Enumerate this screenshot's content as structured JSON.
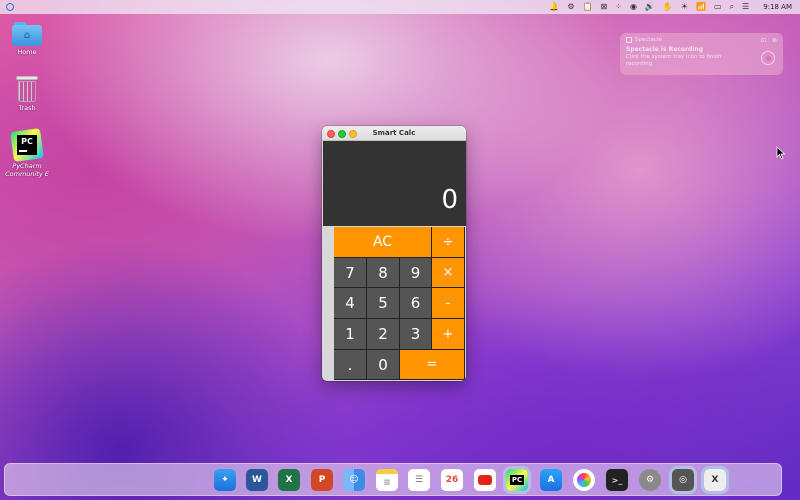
{
  "menubar": {
    "status_icons": [
      "bell-icon",
      "tool-icon",
      "clipboard-icon",
      "close-box-icon",
      "dots-icon",
      "record-icon",
      "volume-icon",
      "hand-icon",
      "brightness-icon",
      "wifi-icon",
      "battery-icon",
      "search-icon",
      "control-center-icon"
    ],
    "time": "9:18 AM"
  },
  "desktop": {
    "icons": [
      {
        "label": "Home"
      },
      {
        "label": "Trash"
      },
      {
        "label_line1": "PyCharm",
        "label_line2": "Community E"
      }
    ]
  },
  "notification": {
    "app": "Spectacle",
    "title": "Spectacle is Recording",
    "message": "Click the system tray icon to finish recording"
  },
  "calculator": {
    "title": "Smart Calc",
    "display": "0",
    "keys": {
      "ac": "AC",
      "divide": "÷",
      "k7": "7",
      "k8": "8",
      "k9": "9",
      "multiply": "×",
      "k4": "4",
      "k5": "5",
      "k6": "6",
      "minus": "-",
      "k1": "1",
      "k2": "2",
      "k3": "3",
      "plus": "+",
      "dot": ".",
      "k0": "0",
      "equals": "="
    },
    "colors": {
      "operator": "#ff9500",
      "number": "#555555",
      "display_bg": "#333333"
    }
  },
  "dock": {
    "items": [
      "apple-icon",
      "safari-icon",
      "word-icon",
      "excel-icon",
      "powerpoint-icon",
      "finder-icon",
      "notes-icon",
      "reminders-icon",
      "calendar-icon",
      "youtube-icon",
      "pycharm-icon",
      "app-store-icon",
      "photos-icon",
      "terminal-icon",
      "system-preferences-icon",
      "screenshot-icon",
      "xquartz-icon"
    ],
    "calendar_text": "26"
  }
}
